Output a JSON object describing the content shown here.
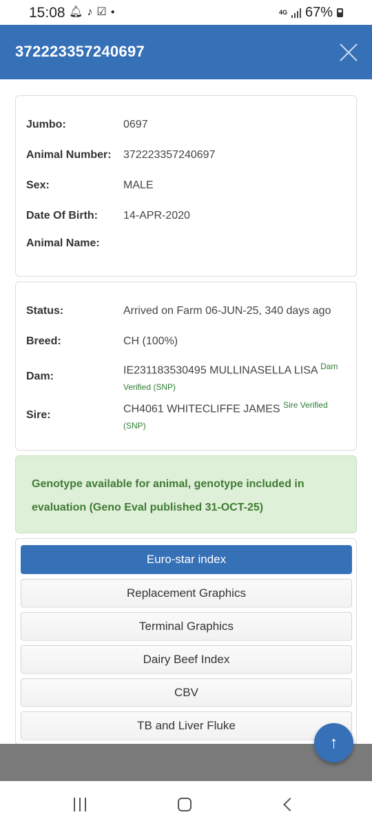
{
  "status_bar": {
    "time": "15:08",
    "battery": "67%",
    "network": "4G"
  },
  "header": {
    "title": "372223357240697"
  },
  "identity": {
    "jumbo_label": "Jumbo:",
    "jumbo_value": "0697",
    "animal_number_label": "Animal Number:",
    "animal_number_value": "372223357240697",
    "sex_label": "Sex:",
    "sex_value": "MALE",
    "dob_label": "Date Of Birth:",
    "dob_value": "14-APR-2020",
    "name_label": "Animal Name:",
    "name_value": ""
  },
  "details": {
    "status_label": "Status:",
    "status_value": "Arrived on Farm 06-JUN-25, 340 days ago",
    "breed_label": "Breed:",
    "breed_value": "CH (100%)",
    "dam_label": "Dam:",
    "dam_value": "IE231183530495 MULLINASELLA LISA",
    "dam_tag_1": "Dam",
    "dam_tag_2": "Verified (SNP)",
    "sire_label": "Sire:",
    "sire_value": "CH4061 WHITECLIFFE JAMES",
    "sire_tag_1": "Sire Verified",
    "sire_tag_2": "(SNP)"
  },
  "genotype_alert": {
    "line1": "Genotype available for animal, genotype included in",
    "line2": "evaluation (Geno Eval published 31-OCT-25)"
  },
  "menu": {
    "items": [
      {
        "label": "Euro-star index",
        "active": true
      },
      {
        "label": "Replacement Graphics",
        "active": false
      },
      {
        "label": "Terminal Graphics",
        "active": false
      },
      {
        "label": "Dairy Beef Index",
        "active": false
      },
      {
        "label": "CBV",
        "active": false
      },
      {
        "label": "TB and Liver Fluke",
        "active": false
      }
    ]
  },
  "fab": {
    "icon": "arrow-up-icon",
    "glyph": "↑"
  },
  "colors": {
    "primary": "#3670b7",
    "success_bg": "#dff0d8",
    "success_text": "#3f7a34",
    "verified_tag": "#2e7d32"
  }
}
